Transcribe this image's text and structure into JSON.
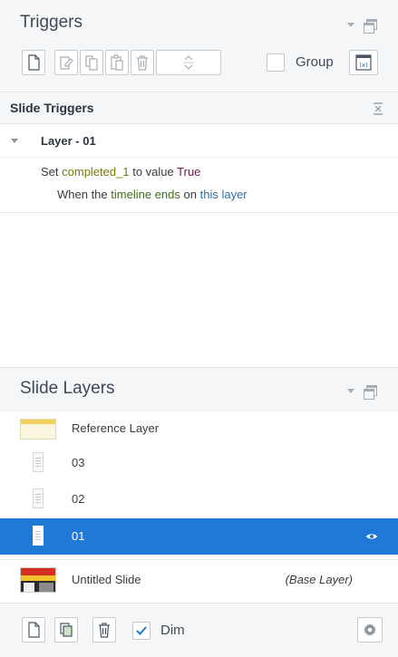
{
  "triggers_panel": {
    "title": "Triggers",
    "toolbar": {
      "new_label": "New trigger",
      "edit_label": "Edit trigger",
      "copy_label": "Copy",
      "paste_label": "Paste",
      "delete_label": "Delete",
      "move_label": "Move up/down"
    },
    "group_label": "Group"
  },
  "slide_triggers": {
    "title": "Slide Triggers",
    "layer_name": "Layer - 01",
    "action_prefix": "Set",
    "variable": "completed_1",
    "action_mid": "to value",
    "value": "True",
    "when_prefix": "When the",
    "event": "timeline ends",
    "when_mid": "on",
    "target": "this layer"
  },
  "slide_layers": {
    "title": "Slide Layers",
    "layers": [
      {
        "name": "Reference Layer"
      },
      {
        "name": "03"
      },
      {
        "name": "02"
      },
      {
        "name": "01"
      },
      {
        "name": "Untitled Slide",
        "tag": "(Base Layer)"
      }
    ],
    "selected_index": 3,
    "dim_label": "Dim",
    "dim_checked": true
  },
  "colors": {
    "selection": "#1f7ad7",
    "header_bg": "#f4f6f8"
  }
}
